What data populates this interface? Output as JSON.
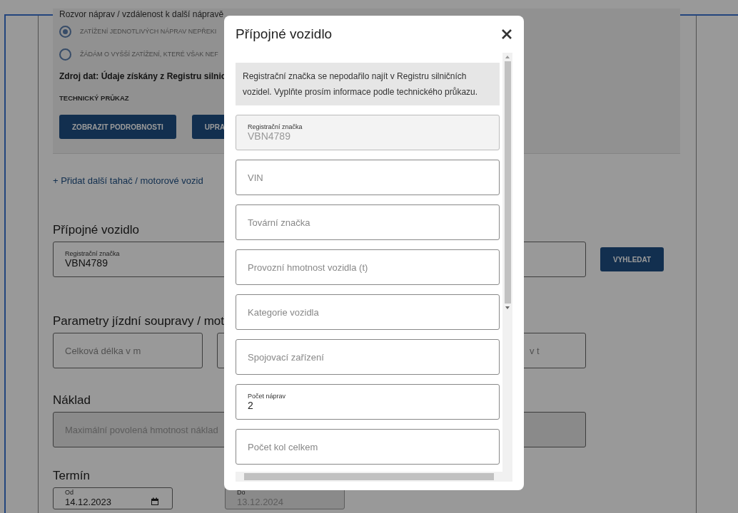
{
  "vehicle_panel": {
    "axle_text": "Rozvor náprav / vzdálenost k další nápravě",
    "options": [
      {
        "label": "ZATÍŽENÍ JEDNOTLIVÝCH NÁPRAV NEPŘEKI",
        "selected": true
      },
      {
        "label": "ŽÁDÁM O VYŠŠÍ ZATÍŽENÍ, KTERÉ VŠAK NEF",
        "selected": false
      }
    ],
    "source": "Zdroj dat: Údaje získány z Registru silnic",
    "document_label": "TECHNICKÝ PRŮKAZ",
    "buttons": [
      "ZOBRAZIT PODROBNOSTI",
      "UPRA"
    ]
  },
  "add_link": "+ Přidat další tahač / motorové vozid",
  "trailer": {
    "heading": "Přípojné vozidlo",
    "field": {
      "label": "Registrační značka",
      "value": "VBN4789"
    },
    "search_button": "VYHLEDAT"
  },
  "parameters": {
    "heading": "Parametry jízdní soupravy / mot",
    "fields": [
      {
        "kind": "text",
        "placeholder": "Celková délka v m"
      },
      {
        "kind": "blank"
      },
      {
        "kind": "text",
        "placeholder": "v t"
      }
    ]
  },
  "cargo": {
    "heading": "Náklad",
    "field": {
      "placeholder": "Maximální povolená hmotnost náklad",
      "disabled": true
    }
  },
  "term": {
    "heading": "Termín",
    "fields": [
      {
        "label": "Od",
        "value": "14.12.2023",
        "disabled": false
      },
      {
        "label": "Do",
        "value": "13.12.2024",
        "disabled": true
      }
    ]
  },
  "modal": {
    "title": "Přípojné vozidlo",
    "notice": "Registrační značka se nepodařilo najít v Registru silničních vozidel. Vyplňte prosím informace podle technického průkazu.",
    "fields": [
      {
        "kind": "filled",
        "label": "Registrační značka",
        "value": "VBN4789",
        "disabled": true
      },
      {
        "kind": "empty",
        "placeholder": "VIN"
      },
      {
        "kind": "empty",
        "placeholder": "Tovární značka"
      },
      {
        "kind": "empty",
        "placeholder": "Provozní hmotnost vozidla (t)"
      },
      {
        "kind": "empty",
        "placeholder": "Kategorie vozidla"
      },
      {
        "kind": "empty",
        "placeholder": "Spojovací zařízení"
      },
      {
        "kind": "filled",
        "label": "Počet náprav",
        "value": "2",
        "disabled": false
      },
      {
        "kind": "empty",
        "placeholder": "Počet kol celkem"
      }
    ]
  }
}
